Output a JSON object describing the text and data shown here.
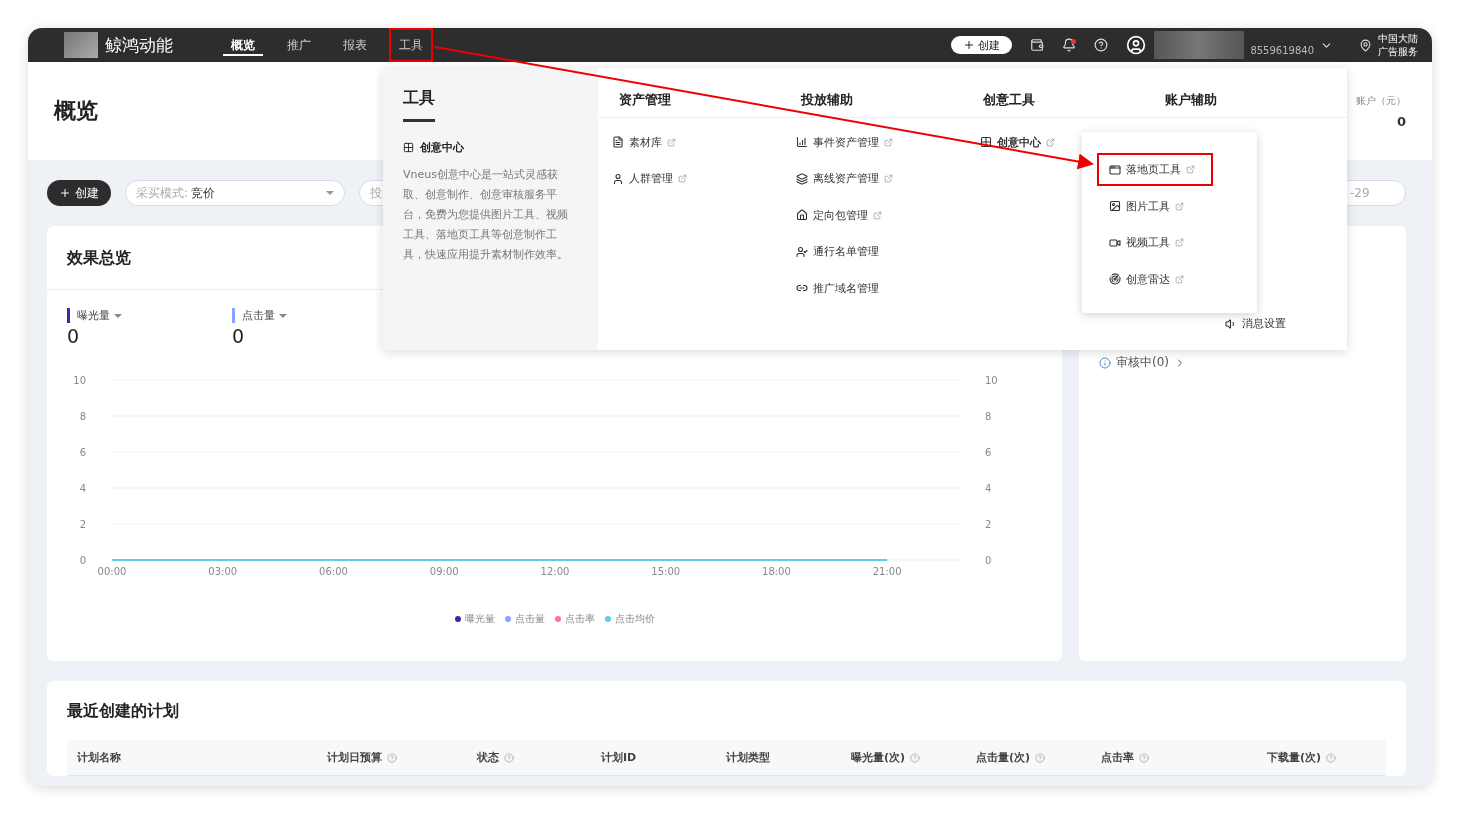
{
  "topbar": {
    "brand": "鲸鸿动能",
    "tabs": [
      {
        "label": "概览",
        "selected": true,
        "annotated": false
      },
      {
        "label": "推广",
        "selected": false,
        "annotated": false
      },
      {
        "label": "报表",
        "selected": false,
        "annotated": false
      },
      {
        "label": "工具",
        "selected": false,
        "annotated": true
      }
    ],
    "create_button": "创建",
    "unread": true,
    "account_id": "8559619840",
    "region": [
      "中国大陆",
      "广告服务"
    ]
  },
  "page_title": "概览",
  "toolbar": {
    "create_button": "创建",
    "filter": {
      "label": "采买模式:",
      "value": "竞价"
    },
    "field_fragment": "投",
    "date_fragment": "-29"
  },
  "balance": {
    "label": "账户（元）",
    "value": "0"
  },
  "overview": {
    "title": "效果总览",
    "metrics": [
      {
        "label": "曝光量",
        "value": "0",
        "color": "#3a28b4"
      },
      {
        "label": "点击量",
        "value": "0",
        "color": "#85a5ff"
      }
    ],
    "chart_data": {
      "type": "line",
      "categories": [
        "00:00",
        "03:00",
        "06:00",
        "09:00",
        "12:00",
        "15:00",
        "18:00",
        "21:00"
      ],
      "ylim": [
        0,
        10
      ],
      "yticks": [
        0,
        2,
        4,
        6,
        8,
        10
      ],
      "y2lim": [
        0,
        10
      ],
      "y2ticks": [
        0,
        2,
        4,
        6,
        8,
        10
      ],
      "grid": true,
      "series": [
        {
          "name": "曝光量",
          "color": "#3a28b4",
          "values": [
            null,
            null,
            null,
            null,
            null,
            null,
            null,
            null
          ]
        },
        {
          "name": "点击量",
          "color": "#85a5ff",
          "values": [
            null,
            null,
            null,
            null,
            null,
            null,
            null,
            null
          ]
        },
        {
          "name": "点击率",
          "color": "#ff6fa6",
          "values": [
            null,
            null,
            null,
            null,
            null,
            null,
            null,
            null
          ]
        },
        {
          "name": "点击均价",
          "color": "#5ccfe6",
          "values": [
            0,
            0,
            0,
            0,
            0,
            0,
            0,
            0
          ]
        }
      ]
    }
  },
  "review": {
    "label": "审核中(0)"
  },
  "dropdown": {
    "title": "工具",
    "feature": {
      "name": "创意中心",
      "description": "Vneus创意中心是一站式灵感获取、创意制作、创意审核服务平台，免费为您提供图片工具、视频工具、落地页工具等创意制作工具，快速应用提升素材制作效率。"
    },
    "columns": [
      {
        "title": "资产管理",
        "items": [
          {
            "label": "素材库",
            "external": true,
            "active": false
          },
          {
            "label": "人群管理",
            "external": true,
            "active": false
          }
        ]
      },
      {
        "title": "投放辅助",
        "items": [
          {
            "label": "事件资产管理",
            "external": true,
            "active": false
          },
          {
            "label": "离线资产管理",
            "external": true,
            "active": false
          },
          {
            "label": "定向包管理",
            "external": true,
            "active": false
          },
          {
            "label": "通行名单管理",
            "external": false,
            "active": false
          },
          {
            "label": "推广域名管理",
            "external": false,
            "active": false
          }
        ]
      },
      {
        "title": "创意工具",
        "items": [
          {
            "label": "创意中心",
            "external": true,
            "active": true,
            "children": [
              {
                "label": "落地页工具",
                "annotated": true
              },
              {
                "label": "图片工具",
                "annotated": false
              },
              {
                "label": "视频工具",
                "annotated": false
              },
              {
                "label": "创意雷达",
                "annotated": false
              }
            ]
          }
        ]
      },
      {
        "title": "账户辅助",
        "items": [
          {
            "label": "消息设置",
            "external": false,
            "active": false
          }
        ]
      }
    ]
  },
  "recent_plans": {
    "title": "最近创建的计划",
    "columns": [
      {
        "label": "计划名称",
        "help": false
      },
      {
        "label": "计划日预算",
        "help": true
      },
      {
        "label": "状态",
        "help": true
      },
      {
        "label": "计划ID",
        "help": false
      },
      {
        "label": "计划类型",
        "help": false
      },
      {
        "label": "曝光量(次)",
        "help": true
      },
      {
        "label": "点击量(次)",
        "help": true
      },
      {
        "label": "点击率",
        "help": true
      },
      {
        "label": "下载量(次)",
        "help": true
      }
    ]
  }
}
